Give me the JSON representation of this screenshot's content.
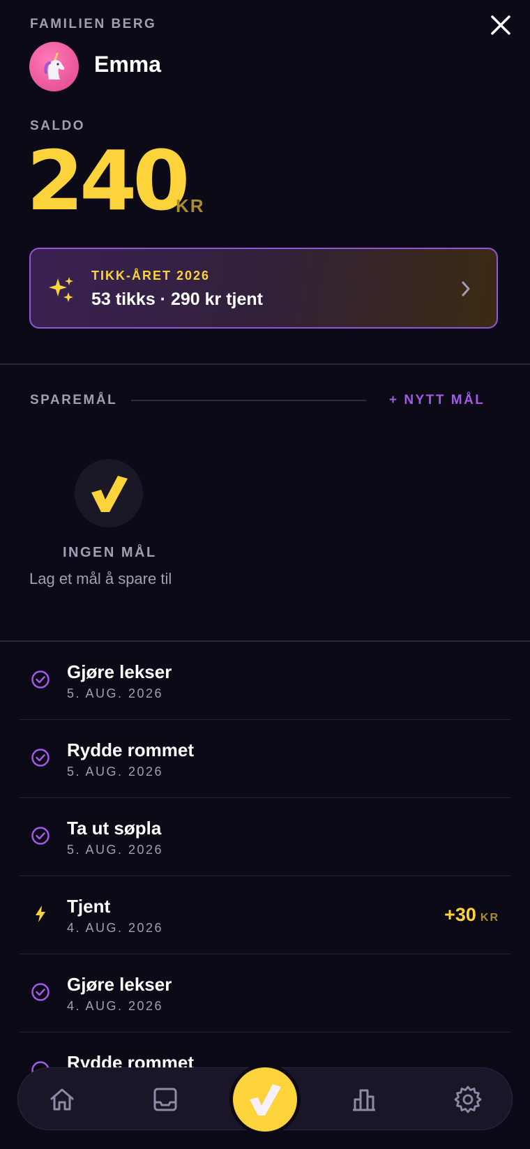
{
  "header": {
    "family": "FAMILIEN BERG",
    "user_name": "Emma",
    "avatar_icon": "unicorn-icon"
  },
  "balance": {
    "label": "SALDO",
    "amount": "240",
    "unit": "KR"
  },
  "year_card": {
    "kicker": "TIKK-ÅRET 2026",
    "summary": "53 tikks · 290 kr tjent"
  },
  "goals": {
    "label": "SPAREMÅL",
    "new_goal_label": "+ NYTT MÅL",
    "empty_title": "INGEN MÅL",
    "empty_subtitle": "Lag et mål å spare til"
  },
  "activity": [
    {
      "title": "Gjøre lekser",
      "date": "5. AUG. 2026",
      "icon": "check-circle-icon"
    },
    {
      "title": "Rydde rommet",
      "date": "5. AUG. 2026",
      "icon": "check-circle-icon"
    },
    {
      "title": "Ta ut søpla",
      "date": "5. AUG. 2026",
      "icon": "check-circle-icon"
    },
    {
      "title": "Tjent",
      "date": "4. AUG. 2026",
      "icon": "lightning-icon",
      "amount": "+30",
      "amount_unit": "KR"
    },
    {
      "title": "Gjøre lekser",
      "date": "4. AUG. 2026",
      "icon": "check-circle-icon"
    },
    {
      "title": "Rydde rommet",
      "date": "",
      "icon": "check-circle-icon"
    }
  ],
  "nav": {
    "items": [
      "home-icon",
      "inbox-icon",
      "check-icon",
      "bar-chart-icon",
      "gear-icon"
    ]
  },
  "colors": {
    "background": "#0b0a16",
    "accent_yellow": "#fdd33b",
    "accent_purple": "#a35ae9",
    "muted_text": "#a29fb4"
  }
}
